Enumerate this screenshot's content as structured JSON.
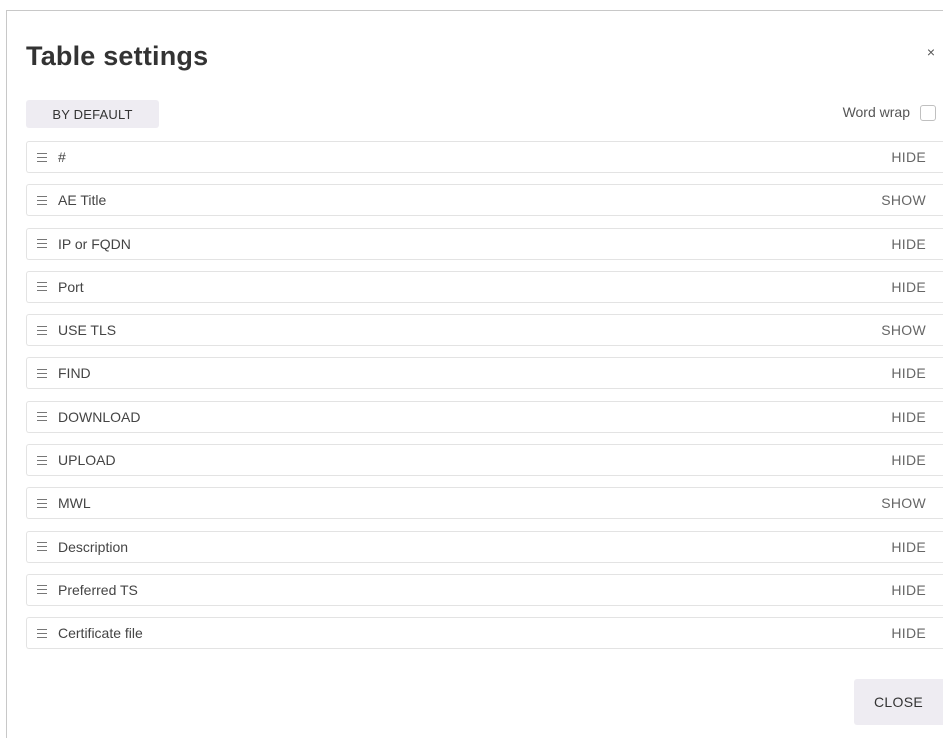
{
  "dialog": {
    "title": "Table settings",
    "close_icon": "×",
    "default_button": "BY DEFAULT",
    "word_wrap_label": "Word wrap",
    "word_wrap_checked": false,
    "close_button": "CLOSE"
  },
  "columns": [
    {
      "label": "#",
      "toggle": "HIDE"
    },
    {
      "label": "AE Title",
      "toggle": "SHOW"
    },
    {
      "label": "IP or FQDN",
      "toggle": "HIDE"
    },
    {
      "label": "Port",
      "toggle": "HIDE"
    },
    {
      "label": "USE TLS",
      "toggle": "SHOW"
    },
    {
      "label": "FIND",
      "toggle": "HIDE"
    },
    {
      "label": "DOWNLOAD",
      "toggle": "HIDE"
    },
    {
      "label": "UPLOAD",
      "toggle": "HIDE"
    },
    {
      "label": "MWL",
      "toggle": "SHOW"
    },
    {
      "label": "Description",
      "toggle": "HIDE"
    },
    {
      "label": "Preferred TS",
      "toggle": "HIDE"
    },
    {
      "label": "Certificate file",
      "toggle": "HIDE"
    }
  ]
}
